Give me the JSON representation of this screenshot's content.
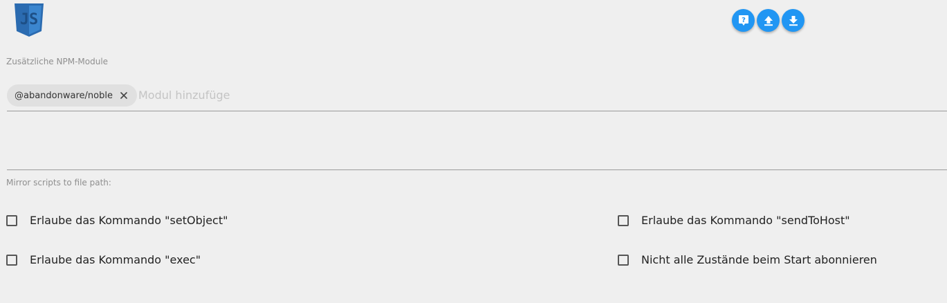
{
  "header": {
    "logo_icon": "javascript-shield-logo",
    "buttons": [
      {
        "icon": "help-icon"
      },
      {
        "icon": "upload-icon"
      },
      {
        "icon": "download-icon"
      }
    ],
    "accent_color": "#2196f3"
  },
  "npm_modules": {
    "label": "Zusätzliche NPM-Module",
    "chips": [
      "@abandonware/noble"
    ],
    "input_placeholder": "Modul hinzufüge",
    "input_value": ""
  },
  "mirror": {
    "textarea_value": "",
    "label": "Mirror scripts to file path:"
  },
  "options": {
    "set_object": {
      "label": "Erlaube das Kommando \"setObject\"",
      "checked": false
    },
    "send_to_host": {
      "label": "Erlaube das Kommando \"sendToHost\"",
      "checked": false
    },
    "exec": {
      "label": "Erlaube das Kommando \"exec\"",
      "checked": false
    },
    "subscribe_all": {
      "label": "Nicht alle Zustände beim Start abonnieren",
      "checked": false
    }
  }
}
